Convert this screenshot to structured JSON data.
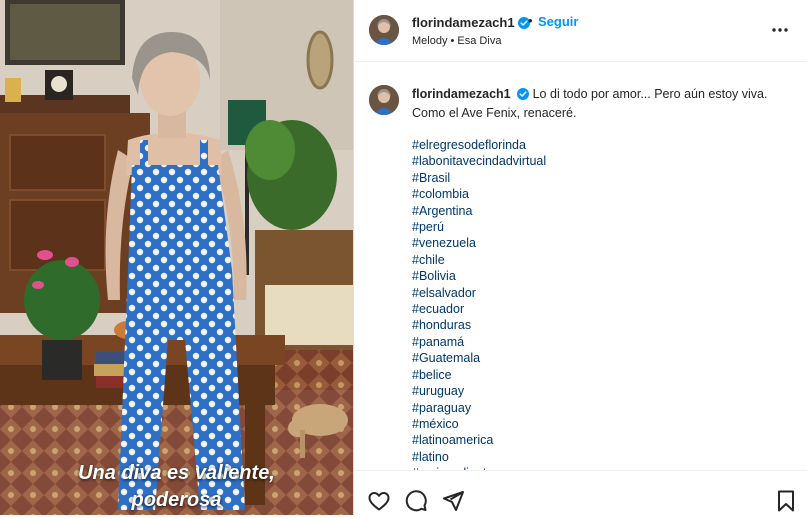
{
  "post": {
    "caption_overlay": [
      "Una diva es valiente,",
      "poderosa"
    ]
  },
  "header": {
    "username": "florindamezach1",
    "dot": "•",
    "follow_label": "Seguir",
    "audio": "Melody • Esa Diva",
    "more_icon": "more-horizontal-icon"
  },
  "comment": {
    "username": "florindamezach1",
    "text": "Lo di todo por amor... Pero aún estoy viva. Como el Ave Fenix, renaceré.",
    "hashtags": [
      "#elregresodeflorinda",
      "#labonitavecindadvirtual",
      "#Brasil",
      "#colombia",
      "#Argentina",
      "#perú",
      "#venezuela",
      "#chile",
      "#Bolivia",
      "#elsalvador",
      "#ecuador",
      "#honduras",
      "#panamá",
      "#Guatemala",
      "#belice",
      "#uruguay",
      "#paraguay",
      "#méxico",
      "#latinoamerica",
      "#latino",
      "#mujervaliente"
    ]
  },
  "actions": {
    "icons": [
      "heart-icon",
      "comment-icon",
      "share-icon",
      "bookmark-icon"
    ]
  },
  "colors": {
    "link_blue": "#0095f6",
    "hashtag_blue": "#00376b",
    "verified_blue": "#0095f6",
    "dress_blue": "#2f6fc4"
  }
}
